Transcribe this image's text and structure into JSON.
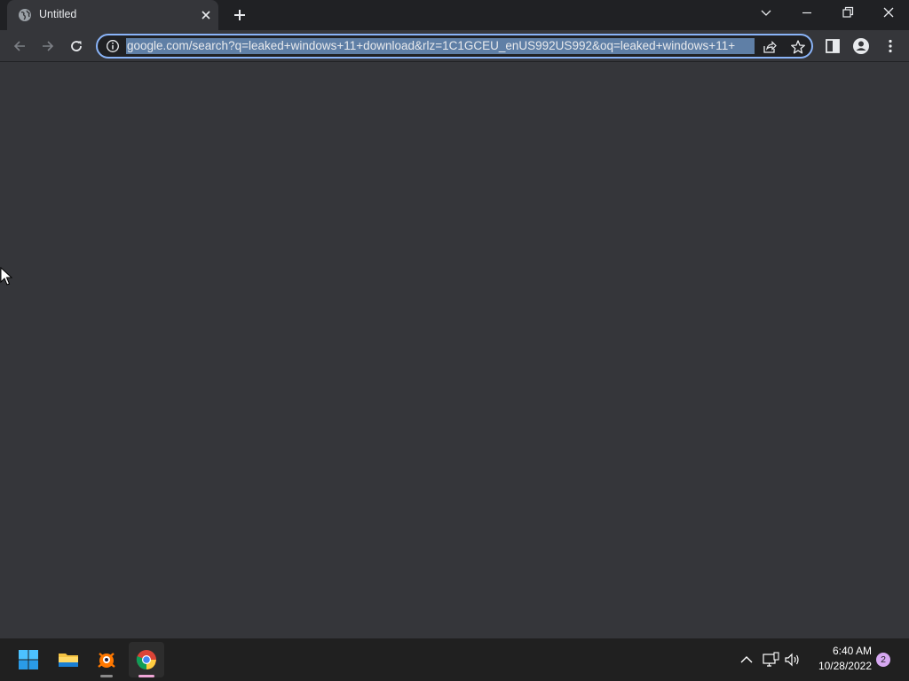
{
  "browser": {
    "tab": {
      "title": "Untitled",
      "favicon": "globe-icon"
    },
    "address_bar": {
      "url": "google.com/search?q=leaked+windows+11+download&rlz=1C1GCEU_enUS992US992&oq=leaked+windows+11+",
      "selected": true,
      "site_info_icon": "info-icon"
    },
    "icons": {
      "back": "arrow-left-icon",
      "forward": "arrow-right-icon",
      "reload": "reload-icon",
      "share": "share-icon",
      "bookmark": "star-icon",
      "side_panel": "side-panel-icon",
      "profile": "profile-icon",
      "menu": "kebab-menu-icon",
      "tab_search": "chevron-down-icon",
      "minimize": "minimize-icon",
      "restore": "restore-icon",
      "close": "close-icon"
    }
  },
  "taskbar": {
    "apps": [
      {
        "name": "Start",
        "icon": "windows-logo-icon"
      },
      {
        "name": "File Explorer",
        "icon": "folder-icon"
      },
      {
        "name": "Avast",
        "icon": "avast-icon",
        "running": true
      },
      {
        "name": "Google Chrome",
        "icon": "chrome-icon",
        "running": true,
        "active": true
      }
    ],
    "tray": {
      "time": "6:40 AM",
      "date": "10/28/2022",
      "notification_count": "2"
    }
  },
  "colors": {
    "chrome_frame": "#202124",
    "chrome_toolbar": "#35363a",
    "omnibox_focus": "#8ab4f8",
    "selection": "#5f7fa6",
    "taskbar": "#202020",
    "notification_badge": "#d7a8f2"
  }
}
